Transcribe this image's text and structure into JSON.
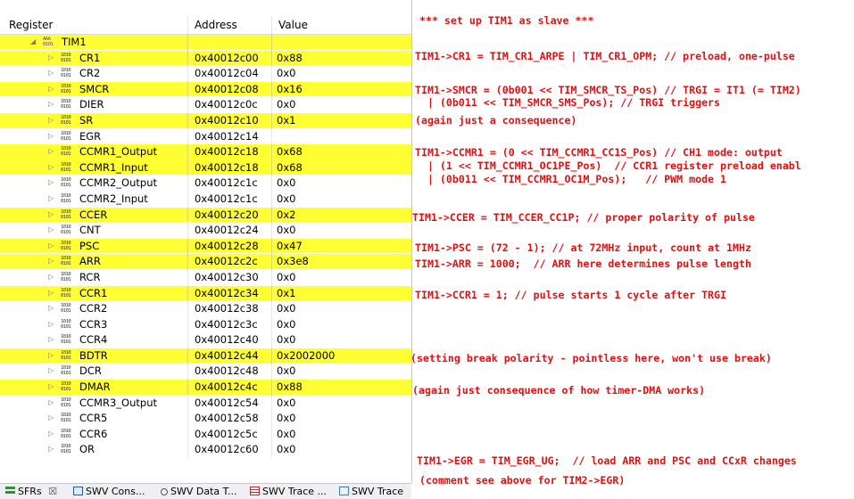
{
  "columns": {
    "register": "Register",
    "address": "Address",
    "value": "Value"
  },
  "group": {
    "name": "TIM1"
  },
  "rows": [
    {
      "name": "CR1",
      "address": "0x40012c00",
      "value": "0x88",
      "hl": true
    },
    {
      "name": "CR2",
      "address": "0x40012c04",
      "value": "0x0",
      "hl": false
    },
    {
      "name": "SMCR",
      "address": "0x40012c08",
      "value": "0x16",
      "hl": true
    },
    {
      "name": "DIER",
      "address": "0x40012c0c",
      "value": "0x0",
      "hl": false
    },
    {
      "name": "SR",
      "address": "0x40012c10",
      "value": "0x1",
      "hl": true
    },
    {
      "name": "EGR",
      "address": "0x40012c14",
      "value": "",
      "hl": false
    },
    {
      "name": "CCMR1_Output",
      "address": "0x40012c18",
      "value": "0x68",
      "hl": true
    },
    {
      "name": "CCMR1_Input",
      "address": "0x40012c18",
      "value": "0x68",
      "hl": true
    },
    {
      "name": "CCMR2_Output",
      "address": "0x40012c1c",
      "value": "0x0",
      "hl": false
    },
    {
      "name": "CCMR2_Input",
      "address": "0x40012c1c",
      "value": "0x0",
      "hl": false
    },
    {
      "name": "CCER",
      "address": "0x40012c20",
      "value": "0x2",
      "hl": true
    },
    {
      "name": "CNT",
      "address": "0x40012c24",
      "value": "0x0",
      "hl": false
    },
    {
      "name": "PSC",
      "address": "0x40012c28",
      "value": "0x47",
      "hl": true
    },
    {
      "name": "ARR",
      "address": "0x40012c2c",
      "value": "0x3e8",
      "hl": true
    },
    {
      "name": "RCR",
      "address": "0x40012c30",
      "value": "0x0",
      "hl": false
    },
    {
      "name": "CCR1",
      "address": "0x40012c34",
      "value": "0x1",
      "hl": true
    },
    {
      "name": "CCR2",
      "address": "0x40012c38",
      "value": "0x0",
      "hl": false
    },
    {
      "name": "CCR3",
      "address": "0x40012c3c",
      "value": "0x0",
      "hl": false
    },
    {
      "name": "CCR4",
      "address": "0x40012c40",
      "value": "0x0",
      "hl": false
    },
    {
      "name": "BDTR",
      "address": "0x40012c44",
      "value": "0x2002000",
      "hl": true
    },
    {
      "name": "DCR",
      "address": "0x40012c48",
      "value": "0x0",
      "hl": false
    },
    {
      "name": "DMAR",
      "address": "0x40012c4c",
      "value": "0x88",
      "hl": true
    },
    {
      "name": "CCMR3_Output",
      "address": "0x40012c54",
      "value": "0x0",
      "hl": false
    },
    {
      "name": "CCR5",
      "address": "0x40012c58",
      "value": "0x0",
      "hl": false
    },
    {
      "name": "CCR6",
      "address": "0x40012c5c",
      "value": "0x0",
      "hl": false
    },
    {
      "name": "OR",
      "address": "0x40012c60",
      "value": "0x0",
      "hl": false
    }
  ],
  "tabs": [
    {
      "label": "SFRs",
      "close": "☒"
    },
    {
      "label": "SWV Cons..."
    },
    {
      "label": "SWV Data T..."
    },
    {
      "label": "SWV Trace ..."
    },
    {
      "label": "SWV Trace"
    }
  ],
  "highlight_color": "#ffff33",
  "annotation_color": "#e01010",
  "annotations": [
    "*** set up TIM1 as slave ***",
    "TIM1->CR1 = TIM_CR1_ARPE | TIM_CR1_OPM; // preload, one-pulse",
    "TIM1->SMCR = (0b001 << TIM_SMCR_TS_Pos) // TRGI = IT1 (= TIM2)",
    "  | (0b011 << TIM_SMCR_SMS_Pos); // TRGI triggers",
    "(again just a consequence)",
    "TIM1->CCMR1 = (0 << TIM_CCMR1_CC1S_Pos) // CH1 mode: output",
    "  | (1 << TIM_CCMR1_OC1PE_Pos)  // CCR1 register preload enabl",
    "  | (0b011 << TIM_CCMR1_OC1M_Pos);   // PWM mode 1",
    "TIM1->CCER = TIM_CCER_CC1P; // proper polarity of pulse",
    "TIM1->PSC = (72 - 1); // at 72MHz input, count at 1MHz",
    "TIM1->ARR = 1000;  // ARR here determines pulse length",
    "TIM1->CCR1 = 1; // pulse starts 1 cycle after TRGI",
    "(setting break polarity - pointless here, won't use break)",
    "(again just consequence of how timer-DMA works)",
    "TIM1->EGR = TIM_EGR_UG;  // load ARR and PSC and CCxR changes",
    "(comment see above for TIM2->EGR)"
  ]
}
